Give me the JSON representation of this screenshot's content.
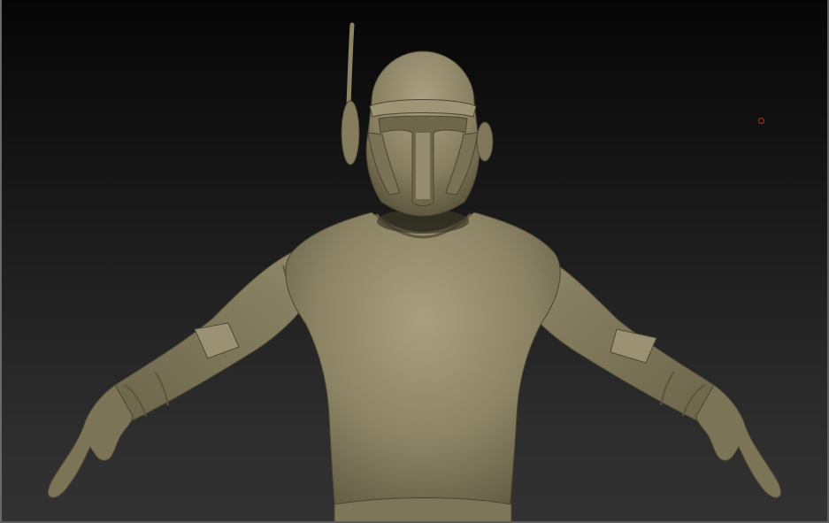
{
  "viewport": {
    "model": "sculpted-character-mesh",
    "material_color": "#8a8262",
    "background_top": "#050505",
    "background_bottom": "#323232",
    "cursor_color": "#c62a2a"
  }
}
